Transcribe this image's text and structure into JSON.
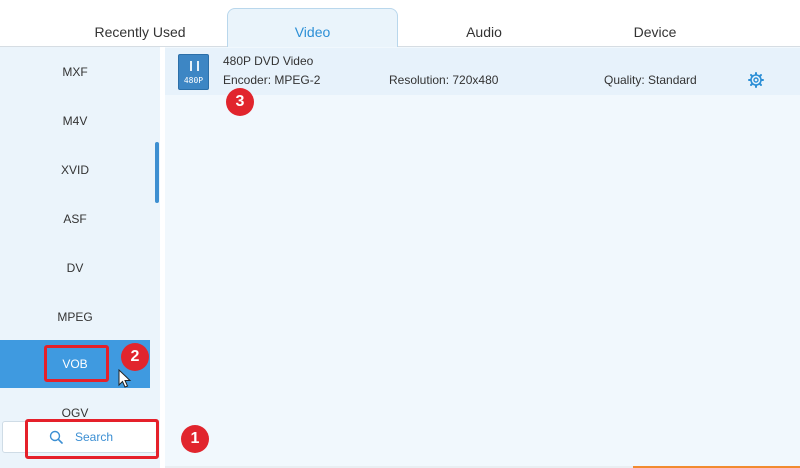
{
  "tabs": [
    {
      "label": "Recently Used"
    },
    {
      "label": "Video"
    },
    {
      "label": "Audio"
    },
    {
      "label": "Device"
    }
  ],
  "active_tab": "Video",
  "sidebar": {
    "items": [
      {
        "label": "MXF"
      },
      {
        "label": "M4V"
      },
      {
        "label": "XVID"
      },
      {
        "label": "ASF"
      },
      {
        "label": "DV"
      },
      {
        "label": "MPEG"
      },
      {
        "label": "VOB"
      },
      {
        "label": "OGV"
      }
    ],
    "selected": "VOB"
  },
  "preset": {
    "icon_label": "480P",
    "title": "480P DVD Video",
    "encoder": "Encoder: MPEG-2",
    "resolution": "Resolution: 720x480",
    "quality": "Quality: Standard"
  },
  "search": {
    "label": "Search"
  },
  "annotations": {
    "badge_1": "1",
    "badge_2": "2",
    "badge_3": "3"
  },
  "colors": {
    "accent": "#3f9ae0",
    "annotation": "#e1252d"
  }
}
